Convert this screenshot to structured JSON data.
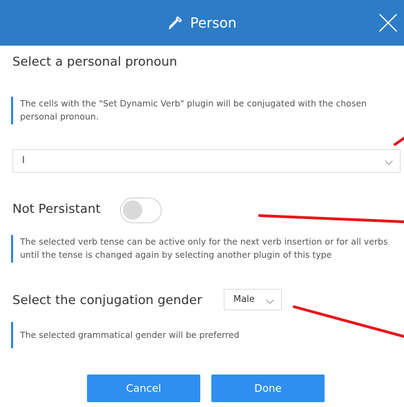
{
  "dialog": {
    "title": "Person",
    "title_icon": "dropper-pen-icon",
    "close_icon": "close-icon"
  },
  "pronoun_section": {
    "heading": "Select a personal pronoun",
    "note": "The cells with the \"Set Dynamic Verb\" plugin will be conjugated with the chosen personal pronoun.",
    "selected_value": "I"
  },
  "persistence_section": {
    "label": "Not Persistant",
    "toggle_on": false,
    "note": "The selected verb tense can be active only for the next verb insertion or for all verbs until the tense is changed again by selecting another plugin of this type"
  },
  "gender_section": {
    "label": "Select the conjugation gender",
    "selected_value": "Male",
    "note": "The selected grammatical gender will be preferred"
  },
  "buttons": {
    "cancel_label": "Cancel",
    "done_label": "Done"
  },
  "colors": {
    "titlebar": "#2e7bc6",
    "accent_button": "#2f8ff0",
    "note_bar": "#2e86de",
    "annotation_arrow": "#e8141a"
  }
}
